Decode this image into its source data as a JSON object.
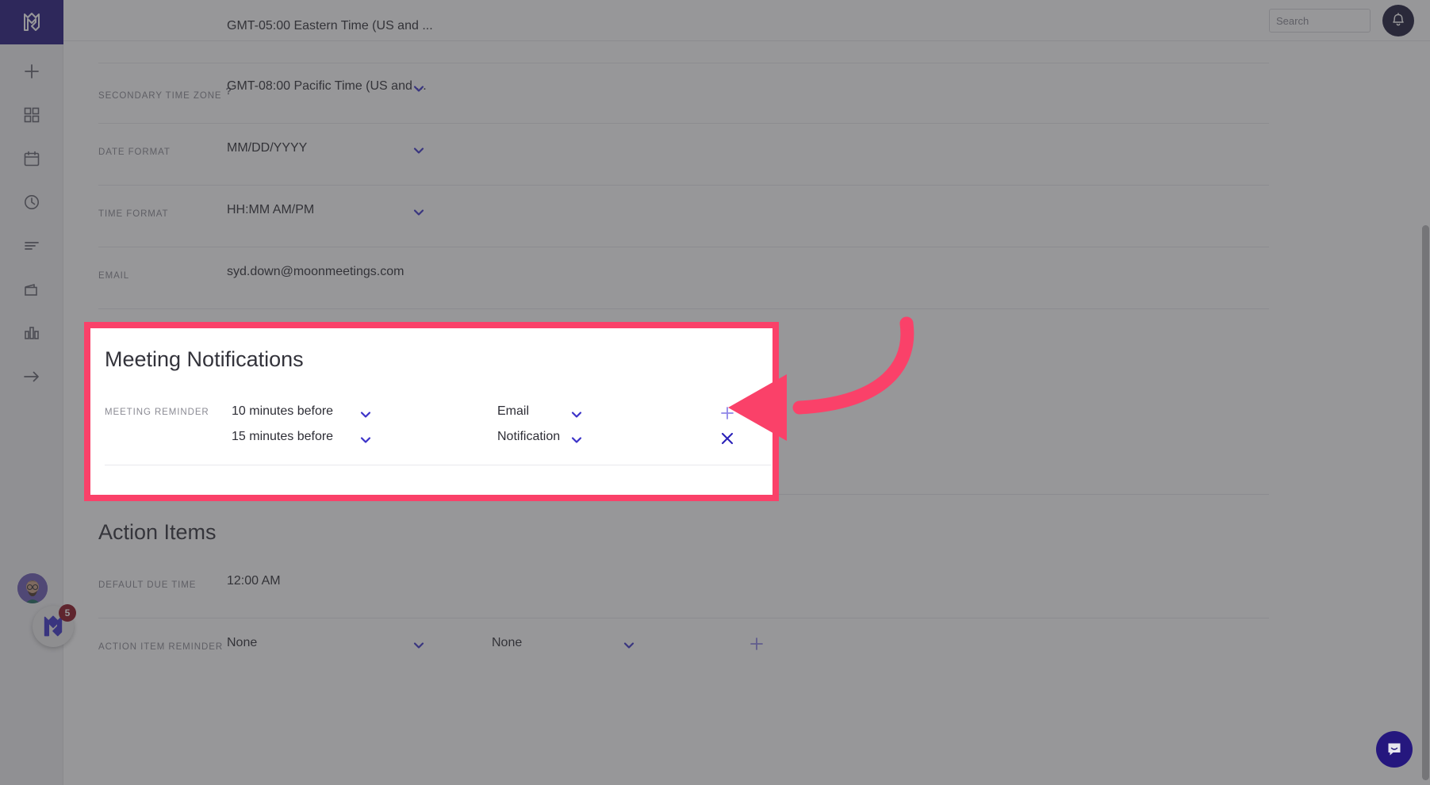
{
  "brand": {
    "logo_icon": "meetingking-logo-icon"
  },
  "sidebar": {
    "items": [
      {
        "name": "add",
        "icon": "plus-icon"
      },
      {
        "name": "dashboard",
        "icon": "grid-icon"
      },
      {
        "name": "calendar",
        "icon": "calendar-icon"
      },
      {
        "name": "history",
        "icon": "clock-icon"
      },
      {
        "name": "tasks",
        "icon": "list-icon"
      },
      {
        "name": "archive",
        "icon": "folder-icon"
      },
      {
        "name": "reports",
        "icon": "chart-bars-icon"
      },
      {
        "name": "expand",
        "icon": "arrow-right-icon"
      }
    ],
    "avatar": {
      "icon": "user-avatar",
      "alt": "User avatar"
    },
    "help": {
      "icon": "meetingking-logo-icon",
      "badge_count": "5"
    }
  },
  "topbar": {
    "search": {
      "value": "",
      "placeholder": "Search",
      "icon": "search-icon"
    },
    "notifications": {
      "icon": "bell-icon"
    }
  },
  "form": {
    "clipped_row_value": "GMT-05:00 Eastern Time (US and ...",
    "rows": [
      {
        "label": "Secondary Time Zone",
        "has_help": true,
        "help_glyph": "?",
        "value": "GMT-08:00 Pacific Time (US and ...",
        "caret": "chevron-down-icon"
      },
      {
        "label": "Date Format",
        "has_help": false,
        "value": "MM/DD/YYYY",
        "caret": "chevron-down-icon"
      },
      {
        "label": "Time Format",
        "has_help": false,
        "value": "HH:MM AM/PM",
        "caret": "chevron-down-icon"
      },
      {
        "label": "Email",
        "has_help": false,
        "value": "syd.down@moonmeetings.com",
        "caret": null
      }
    ]
  },
  "meeting_notifications": {
    "title": "Meeting Notifications",
    "reminder_label": "Meeting Reminder",
    "reminders": [
      {
        "when": "10 minutes before",
        "how": "Email",
        "action": "add",
        "action_icon": "plus-icon"
      },
      {
        "when": "15 minutes before",
        "how": "Notification",
        "action": "remove",
        "action_icon": "close-x-icon"
      }
    ]
  },
  "action_items": {
    "title": "Action Items",
    "rows": [
      {
        "label": "Default Due Time",
        "value": "12:00 AM",
        "caret": null
      },
      {
        "label": "Action Item Reminder",
        "value": "None",
        "value2": "None",
        "caret": "chevron-down-icon",
        "action_icon": "plus-icon"
      }
    ]
  },
  "annotation": {
    "arrow_icon": "curved-arrow-left-icon",
    "highlight_color": "#fa4169"
  },
  "chat": {
    "icon": "chat-bubble-icon"
  },
  "colors": {
    "brand_purple": "#25177e",
    "accent_pink": "#fa4169",
    "caret_blue": "#3b32c8",
    "badge_red": "#8b1220"
  }
}
